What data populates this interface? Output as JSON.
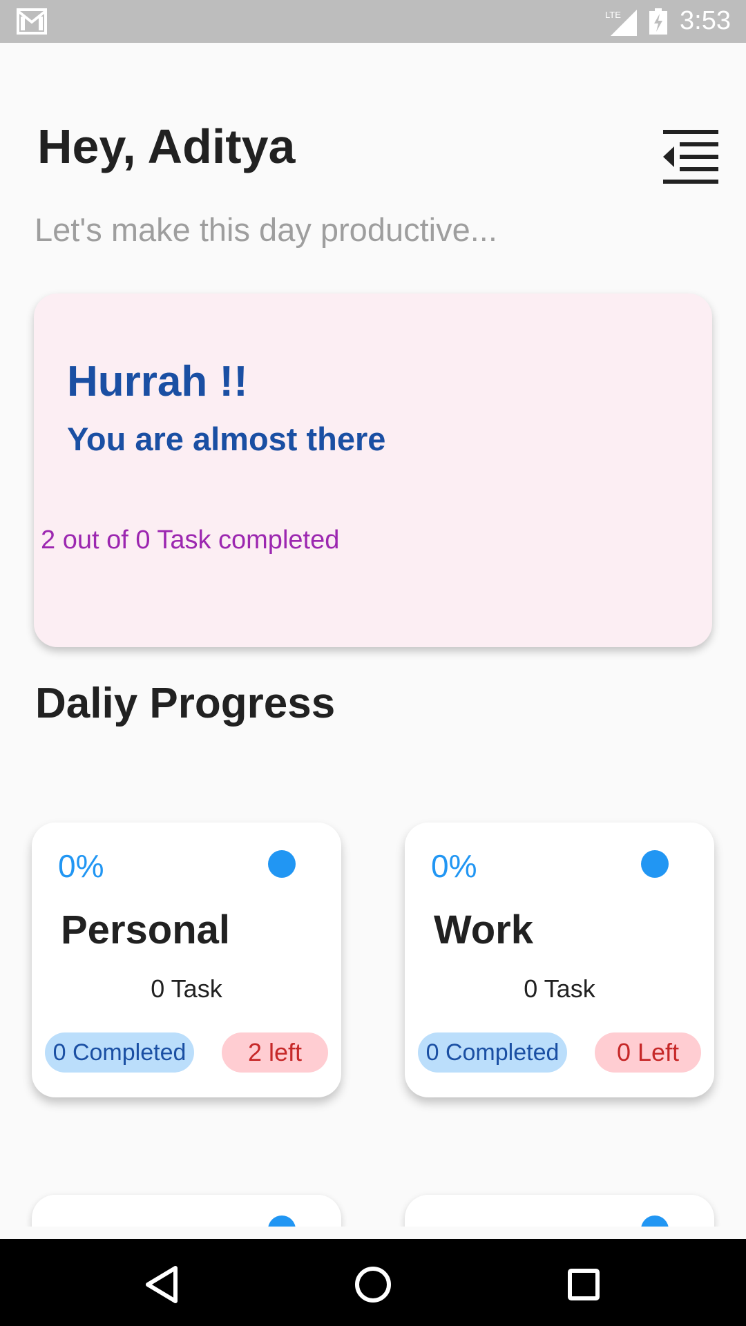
{
  "status_bar": {
    "time": "3:53",
    "network": "LTE",
    "icons": [
      "mail-icon",
      "lte-signal-icon",
      "battery-charging-icon"
    ]
  },
  "header": {
    "greeting": "Hey, Aditya",
    "subtitle": "Let's make this day productive...",
    "menu_icon": "indent-menu-icon"
  },
  "hero": {
    "title": "Hurrah !!",
    "subtitle": "You are almost there",
    "progress_text": "2 out of 0 Task completed",
    "background": "#fceef3"
  },
  "section_title": "Daliy Progress",
  "categories": [
    {
      "percent": "0%",
      "name": "Personal",
      "task_count": "0 Task",
      "completed": "0 Completed",
      "left": "2 left"
    },
    {
      "percent": "0%",
      "name": "Work",
      "task_count": "0 Task",
      "completed": "0 Completed",
      "left": "0 Left"
    }
  ],
  "colors": {
    "accent": "#2196f3",
    "hero_text": "#1a4fa3",
    "progress_text": "#9c27b0",
    "completed_pill": "#bbdefb",
    "left_pill": "#ffcdd2"
  },
  "nav_bar": {
    "icons": [
      "back-icon",
      "home-icon",
      "recents-icon"
    ]
  }
}
